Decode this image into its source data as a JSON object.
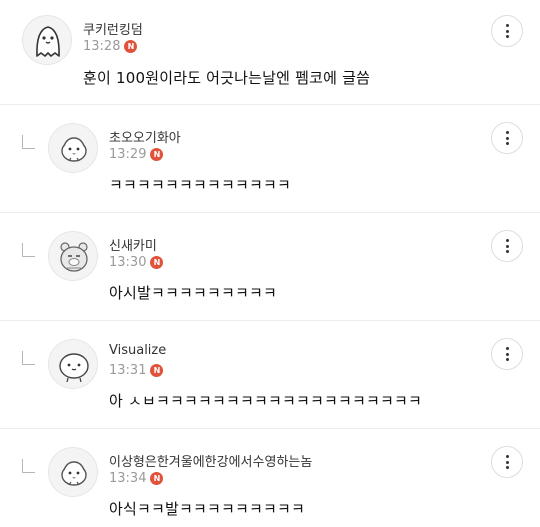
{
  "comments": [
    {
      "author": "쿠키런킹덤",
      "time": "13:28",
      "badge": "N",
      "text": "훈이 100원이라도 어긋나는날엔 펨코에 글씀",
      "avatar_icon": "ghost-avatar-icon",
      "is_reply": false
    },
    {
      "author": "초오오기화아",
      "time": "13:29",
      "badge": "N",
      "text": "ㅋㅋㅋㅋㅋㅋㅋㅋㅋㅋㅋㅋㅋ",
      "avatar_icon": "bird-avatar-icon",
      "is_reply": true
    },
    {
      "author": "신새카미",
      "time": "13:30",
      "badge": "N",
      "text": "아시발ㅋㅋㅋㅋㅋㅋㅋㅋㅋ",
      "avatar_icon": "bear-avatar-icon",
      "is_reply": true
    },
    {
      "author": "Visualize",
      "time": "13:31",
      "badge": "N",
      "text": "아 ㅅㅂㅋㅋㅋㅋㅋㅋㅋㅋㅋㅋㅋㅋㅋㅋㅋㅋㅋㅋㅋ",
      "avatar_icon": "blob-avatar-icon",
      "is_reply": true
    },
    {
      "author": "이상형은한겨울에한강에서수영하는놈",
      "time": "13:34",
      "badge": "N",
      "text": "아식ㅋㅋ발ㅋㅋㅋㅋㅋㅋㅋㅋㅋ",
      "avatar_icon": "bird-avatar-icon",
      "is_reply": true
    }
  ],
  "colors": {
    "badge": "#e0533a",
    "divider": "#ececec",
    "time": "#9a9a9a"
  },
  "icons": {
    "more": "more-vertical-icon",
    "reply": "reply-arrow-icon"
  }
}
